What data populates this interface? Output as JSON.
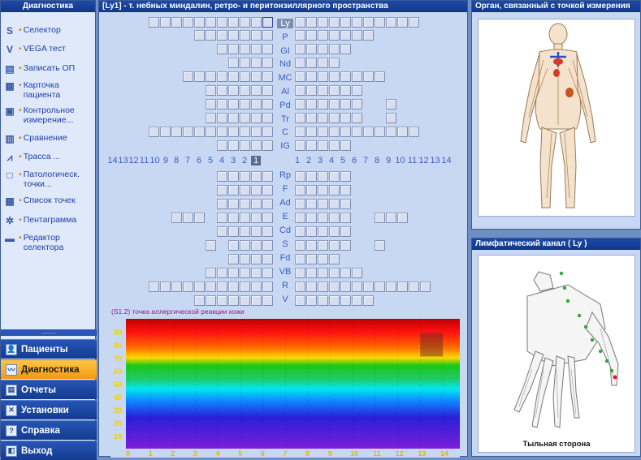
{
  "sidebar": {
    "title": "Диагностика",
    "items": [
      {
        "label": "Селектор",
        "icon": "selector-icon",
        "glyph": "S"
      },
      {
        "label": "VEGA тест",
        "icon": "vega-icon",
        "glyph": "V"
      },
      {
        "label": "Записать ОП",
        "icon": "save-icon",
        "glyph": "▤"
      },
      {
        "label": "Карточка пациента",
        "icon": "card-icon",
        "glyph": "▦"
      },
      {
        "label": "Контрольное измерение...",
        "icon": "measure-icon",
        "glyph": "▣"
      },
      {
        "label": "Сравнение",
        "icon": "compare-icon",
        "glyph": "▥"
      },
      {
        "label": "Трасса ...",
        "icon": "trace-icon",
        "glyph": "⩘"
      },
      {
        "label": "Патологическ. точки...",
        "icon": "points-icon",
        "glyph": "□"
      },
      {
        "label": "Список точек",
        "icon": "list-icon",
        "glyph": "▦"
      },
      {
        "label": "Пентаграмма",
        "icon": "pentagram-icon",
        "glyph": "✲"
      },
      {
        "label": "Редактор селектора",
        "icon": "editor-icon",
        "glyph": "▬"
      }
    ],
    "handle": "........"
  },
  "nav": [
    {
      "label": "Пациенты",
      "icon": "patients-icon",
      "glyph": "👤",
      "active": false
    },
    {
      "label": "Диагностика",
      "icon": "diagnostics-icon",
      "glyph": "〰",
      "active": true
    },
    {
      "label": "Отчеты",
      "icon": "reports-icon",
      "glyph": "▤",
      "active": false
    },
    {
      "label": "Установки",
      "icon": "settings-icon",
      "glyph": "✕",
      "active": false
    },
    {
      "label": "Справка",
      "icon": "help-icon",
      "glyph": "?",
      "active": false
    },
    {
      "label": "Выход",
      "icon": "exit-icon",
      "glyph": "◧",
      "active": false
    }
  ],
  "center": {
    "title": "[Ly1] - т. небных миндалин, ретро- и перитонзиллярного пространства",
    "meridians_top": [
      "Ly",
      "P",
      "GI",
      "Nd",
      "MC",
      "Al",
      "Pd",
      "Tr",
      "C",
      "IG"
    ],
    "meridians_bottom": [
      "Rp",
      "F",
      "Ad",
      "E",
      "Cd",
      "S",
      "Fd",
      "VB",
      "R",
      "V"
    ],
    "selected_meridian": "Ly",
    "left_numbers": [
      "14",
      "13",
      "12",
      "11",
      "10",
      "9",
      "8",
      "7",
      "6",
      "5",
      "4",
      "3",
      "2",
      "1"
    ],
    "right_numbers": [
      "1",
      "2",
      "3",
      "4",
      "5",
      "6",
      "7",
      "8",
      "9",
      "10",
      "11",
      "12",
      "13",
      "14"
    ],
    "selected_number": "1",
    "note": "(S1.2) точка аллергической реакции кожи"
  },
  "chart_data": {
    "type": "heatmap",
    "y_ticks": [
      "90",
      "80",
      "70",
      "60",
      "50",
      "40",
      "30",
      "20",
      "10"
    ],
    "x_ticks": [
      "0",
      "1",
      "2",
      "3",
      "4",
      "5",
      "6",
      "7",
      "8",
      "9",
      "10",
      "11",
      "12",
      "13",
      "14"
    ],
    "ylim": [
      0,
      100
    ],
    "xlim": [
      0,
      14
    ],
    "highlight": {
      "x": [
        13,
        14
      ],
      "y": [
        71,
        89
      ]
    }
  },
  "organ_panel": {
    "title": "Орган, связанный с точкой измерения"
  },
  "channel_panel": {
    "title": "Лимфатический канал ( Ly )",
    "caption": "Тыльная сторона"
  }
}
